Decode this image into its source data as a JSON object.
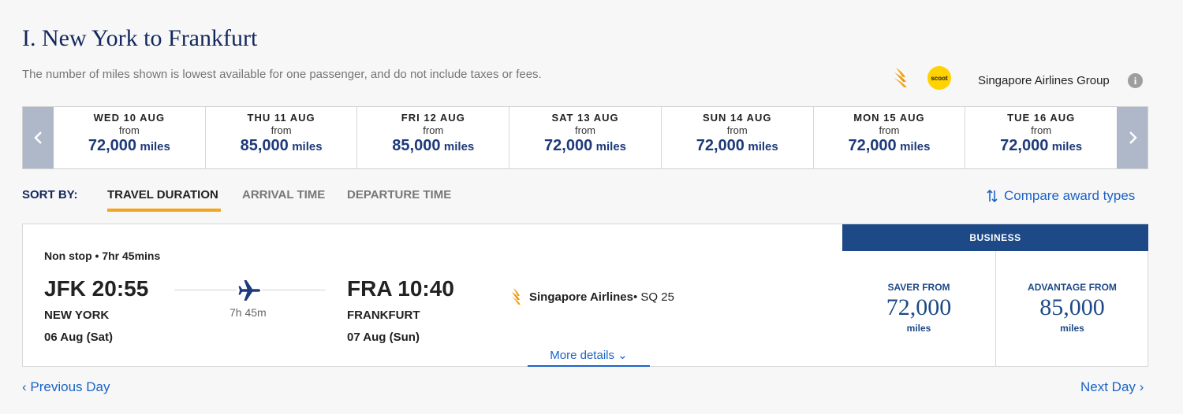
{
  "header": {
    "title": "I. New York to Frankfurt",
    "subtitle": "The number of miles shown is lowest available for one passenger, and do not include taxes or fees.",
    "scoot_logo_text": "scoot",
    "group_label": "Singapore Airlines Group",
    "info_icon_glyph": "i"
  },
  "date_bar": {
    "from_label": "from",
    "unit": "miles",
    "dates": [
      {
        "label": "WED 10 AUG",
        "miles": "72,000"
      },
      {
        "label": "THU 11 AUG",
        "miles": "85,000"
      },
      {
        "label": "FRI 12 AUG",
        "miles": "85,000"
      },
      {
        "label": "SAT 13 AUG",
        "miles": "72,000"
      },
      {
        "label": "SUN 14 AUG",
        "miles": "72,000"
      },
      {
        "label": "MON 15 AUG",
        "miles": "72,000"
      },
      {
        "label": "TUE 16 AUG",
        "miles": "72,000"
      }
    ]
  },
  "sort": {
    "label": "SORT BY:",
    "tabs": [
      "TRAVEL DURATION",
      "ARRIVAL TIME",
      "DEPARTURE TIME"
    ],
    "active": "TRAVEL DURATION",
    "compare": "Compare award types"
  },
  "flight": {
    "stops": "Non stop • 7hr 45mins",
    "departure": {
      "time": "JFK 20:55",
      "city": "NEW YORK",
      "date": "06 Aug (Sat)"
    },
    "arrival": {
      "time": "FRA 10:40",
      "city": "FRANKFURT",
      "date": "07 Aug (Sun)"
    },
    "duration": "7h 45m",
    "airline": "Singapore Airlines",
    "flight_no": " • SQ 25",
    "more_details": "More details ⌄",
    "cabin": "BUSINESS",
    "saver": {
      "label": "SAVER FROM",
      "miles": "72,000",
      "unit": "miles"
    },
    "advantage": {
      "label": "ADVANTAGE FROM",
      "miles": "85,000",
      "unit": "miles"
    }
  },
  "footer": {
    "prev": "‹ Previous Day",
    "next": "Next Day ›"
  },
  "colors": {
    "navy": "#13275c",
    "brand_blue": "#1d4a86",
    "link_blue": "#1c63c7",
    "accent_orange": "#f5a51b",
    "arrow_bg": "#aeb8c9"
  }
}
